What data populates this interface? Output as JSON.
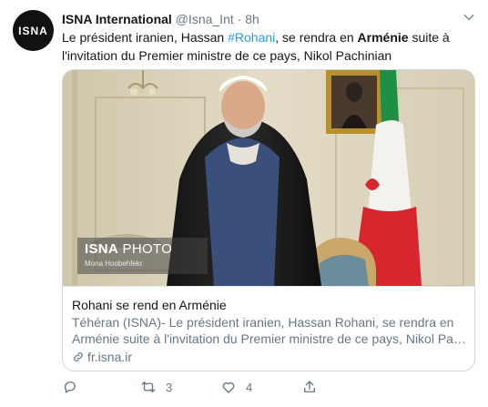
{
  "tweet": {
    "avatar_text": "ISNA",
    "author_name": "ISNA International",
    "author_handle": "@Isna_Int",
    "separator": "·",
    "time": "8h",
    "text_parts": [
      "Le président iranien, Hassan ",
      "#Rohani",
      ", se rendra en ",
      "Arménie",
      " suite à l'invitation du Premier ministre de ce pays, Nikol Pachinian"
    ]
  },
  "card": {
    "watermark_bold": "ISNA",
    "watermark_thin": " PHOTO",
    "watermark_credit": "Mona Hoobehfekr",
    "title": "Rohani se rend en Arménie",
    "description_line1": "Téhéran (ISNA)- Le président iranien, Hassan Rohani, se rendra en",
    "description_line2": "Arménie suite à l'invitation du Premier ministre de ce pays, Nikol Pachinia...",
    "domain": "fr.isna.ir"
  },
  "actions": {
    "reply_count": "",
    "retweet_count": "3",
    "like_count": "4",
    "share_count": ""
  },
  "colors": {
    "link": "#1da1f2",
    "secondary_text": "#657786",
    "border": "#ccd6dd"
  },
  "icons": [
    "avatar-isna-logo",
    "chevron-down-icon",
    "link-icon",
    "reply-icon",
    "retweet-icon",
    "like-icon",
    "share-icon"
  ]
}
